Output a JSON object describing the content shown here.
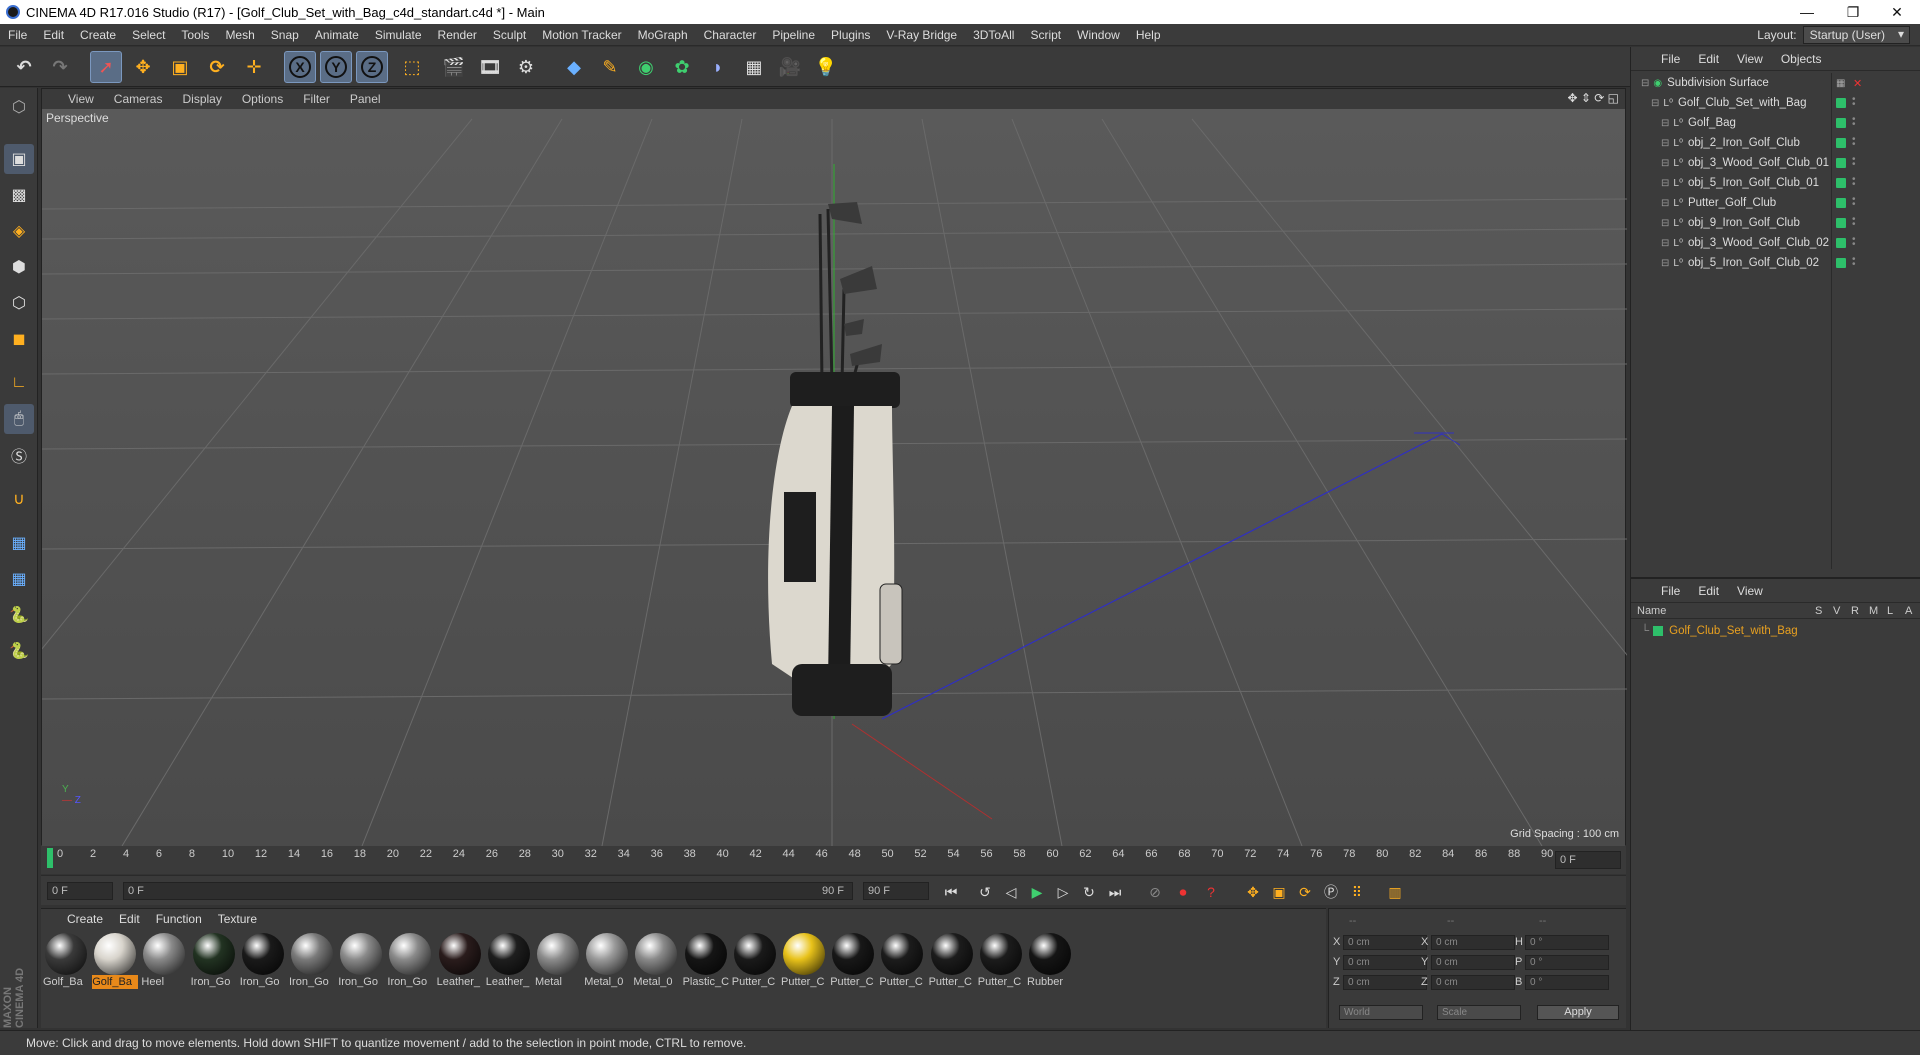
{
  "window": {
    "title": "CINEMA 4D R17.016 Studio (R17) - [Golf_Club_Set_with_Bag_c4d_standart.c4d *] - Main"
  },
  "menu": [
    "File",
    "Edit",
    "Create",
    "Select",
    "Tools",
    "Mesh",
    "Snap",
    "Animate",
    "Simulate",
    "Render",
    "Sculpt",
    "Motion Tracker",
    "MoGraph",
    "Character",
    "Pipeline",
    "Plugins",
    "V-Ray Bridge",
    "3DToAll",
    "Script",
    "Window",
    "Help"
  ],
  "layout": {
    "label": "Layout:",
    "value": "Startup (User)"
  },
  "toolbar": {
    "axis_x": "X",
    "axis_y": "Y",
    "axis_z": "Z"
  },
  "viewport": {
    "menu": [
      "View",
      "Cameras",
      "Display",
      "Options",
      "Filter",
      "Panel"
    ],
    "label": "Perspective",
    "grid_spacing": "Grid Spacing : 100 cm"
  },
  "object_manager": {
    "menu": [
      "File",
      "Edit",
      "View",
      "Objects"
    ],
    "items": [
      {
        "name": "Subdivision Surface"
      },
      {
        "name": "Golf_Club_Set_with_Bag"
      },
      {
        "name": "Golf_Bag"
      },
      {
        "name": "obj_2_Iron_Golf_Club"
      },
      {
        "name": "obj_3_Wood_Golf_Club_01"
      },
      {
        "name": "obj_5_Iron_Golf_Club_01"
      },
      {
        "name": "Putter_Golf_Club"
      },
      {
        "name": "obj_9_Iron_Golf_Club"
      },
      {
        "name": "obj_3_Wood_Golf_Club_02"
      },
      {
        "name": "obj_5_Iron_Golf_Club_02"
      }
    ]
  },
  "attribute_manager": {
    "menu": [
      "File",
      "Edit",
      "View"
    ],
    "columns": {
      "name": "Name",
      "s": "S",
      "v": "V",
      "r": "R",
      "m": "M",
      "l": "L",
      "a": "A"
    },
    "item": "Golf_Club_Set_with_Bag"
  },
  "timeline": {
    "ticks": [
      "0",
      "2",
      "4",
      "6",
      "8",
      "10",
      "12",
      "14",
      "16",
      "18",
      "20",
      "22",
      "24",
      "26",
      "28",
      "30",
      "32",
      "34",
      "36",
      "38",
      "40",
      "42",
      "44",
      "46",
      "48",
      "50",
      "52",
      "54",
      "56",
      "58",
      "60",
      "62",
      "64",
      "66",
      "68",
      "70",
      "72",
      "74",
      "76",
      "78",
      "80",
      "82",
      "84",
      "86",
      "88",
      "90"
    ],
    "end_field": "0 F"
  },
  "playback": {
    "start": "0 F",
    "range_start": "0 F",
    "range_end": "90 F",
    "end": "90 F"
  },
  "material_manager": {
    "menu": [
      "Create",
      "Edit",
      "Function",
      "Texture"
    ],
    "materials": [
      {
        "label": "Golf_Ba",
        "color": "#3a3a3a"
      },
      {
        "label": "Golf_Ba",
        "color": "#d8d4cc",
        "selected": true
      },
      {
        "label": "Heel",
        "color": "#8a8a8a"
      },
      {
        "label": "Iron_Go",
        "color": "#223322"
      },
      {
        "label": "Iron_Go",
        "color": "#1a1a1a"
      },
      {
        "label": "Iron_Go",
        "color": "#7a7a7a"
      },
      {
        "label": "Iron_Go",
        "color": "#8a8a8a"
      },
      {
        "label": "Iron_Go",
        "color": "#8a8a8a"
      },
      {
        "label": "Leather_",
        "color": "#2a1c1c"
      },
      {
        "label": "Leather_",
        "color": "#1e1e1e"
      },
      {
        "label": "Metal",
        "color": "#8c8c8c"
      },
      {
        "label": "Metal_0",
        "color": "#9a9a9a"
      },
      {
        "label": "Metal_0",
        "color": "#8a8a8a"
      },
      {
        "label": "Plastic_C",
        "color": "#151515"
      },
      {
        "label": "Putter_C",
        "color": "#1a1a1a"
      },
      {
        "label": "Putter_C",
        "color": "#e8c21a"
      },
      {
        "label": "Putter_C",
        "color": "#181818"
      },
      {
        "label": "Putter_C",
        "color": "#1c1c1c"
      },
      {
        "label": "Putter_C",
        "color": "#1c1c1c"
      },
      {
        "label": "Putter_C",
        "color": "#1c1c1c"
      },
      {
        "label": "Rubber",
        "color": "#151515"
      }
    ]
  },
  "coordinates": {
    "header": [
      "--",
      "--",
      "--"
    ],
    "rows": [
      {
        "a": "X",
        "av": "0 cm",
        "b": "X",
        "bv": "0 cm",
        "c": "H",
        "cv": "0 °"
      },
      {
        "a": "Y",
        "av": "0 cm",
        "b": "Y",
        "bv": "0 cm",
        "c": "P",
        "cv": "0 °"
      },
      {
        "a": "Z",
        "av": "0 cm",
        "b": "Z",
        "bv": "0 cm",
        "c": "B",
        "cv": "0 °"
      }
    ],
    "mode": "World",
    "scale": "Scale",
    "apply": "Apply"
  },
  "status": "Move: Click and drag to move elements. Hold down SHIFT to quantize movement / add to the selection in point mode, CTRL to remove."
}
